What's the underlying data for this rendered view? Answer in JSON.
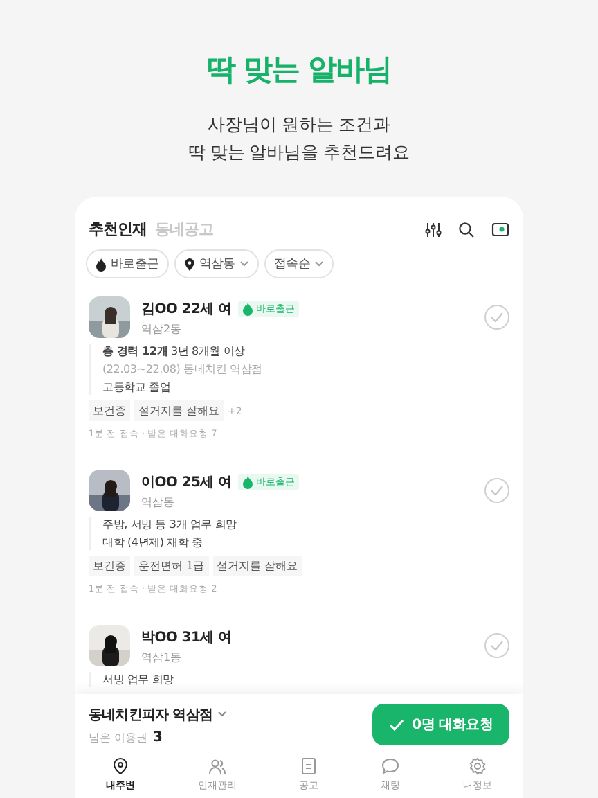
{
  "hero": {
    "title": "딱 맞는 알바님",
    "subtitle": [
      "사장님이 원하는 조건과",
      "딱 맞는 알바님을 추천드려요"
    ]
  },
  "tabs": [
    {
      "label": "추천인재",
      "selected": true
    },
    {
      "label": "동네공고",
      "selected": false
    }
  ],
  "filters": [
    {
      "label": "바로출근",
      "dropdown": false
    },
    {
      "label": "역삼동",
      "dropdown": true
    },
    {
      "label": "접속순",
      "dropdown": true
    }
  ],
  "candidates": [
    {
      "name": "김OO 22세 여",
      "badge": "바로출근",
      "location": "역삼2동",
      "selected": false,
      "details": [
        {
          "kind": "main",
          "text": "**총 경력 12개** 3년 8개월 이상"
        },
        {
          "kind": "sub",
          "text": "(22.03~22.08) 동네치킨 역삼점"
        },
        {
          "kind": "main",
          "text": "고등학교 졸업"
        }
      ],
      "tags": [
        "보건증",
        "설거지를 잘해요"
      ],
      "more": "+2",
      "meta": "1분 전 접속 · 받은 대화요청 7"
    },
    {
      "name": "이OO 25세 여",
      "badge": "바로출근",
      "location": "역삼동",
      "selected": false,
      "details": [
        {
          "kind": "main",
          "text": "주방, 서빙 등 3개 업무 희망"
        },
        {
          "kind": "main",
          "text": "대학 (4년제) 재학 중"
        }
      ],
      "tags": [
        "보건증",
        "운전면허 1급",
        "설거지를 잘해요"
      ],
      "meta": "1분 전 접속 · 받은 대화요청 2"
    },
    {
      "name": "박OO 31세 여",
      "location": "역삼1동",
      "selected": false,
      "details": [
        {
          "kind": "main",
          "text": "서빙 업무 희망"
        }
      ]
    }
  ],
  "store": {
    "name": "동네치킨피자 역삼점",
    "tickets_label": "남은 이용권",
    "tickets": "3"
  },
  "request_button": "0명 대화요청",
  "nav": [
    {
      "label": "내주변",
      "selected": true
    },
    {
      "label": "인재관리",
      "selected": false
    },
    {
      "label": "공고",
      "selected": false
    },
    {
      "label": "채팅",
      "selected": false
    },
    {
      "label": "내정보",
      "selected": false
    }
  ]
}
